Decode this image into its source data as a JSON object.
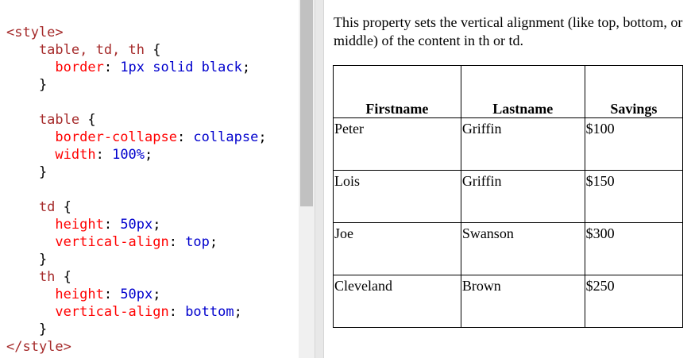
{
  "code_lines": [
    [
      {
        "t": "tag",
        "s": "<style>"
      }
    ],
    [
      {
        "t": "sel",
        "s": "    table, td, th "
      },
      {
        "t": "punc",
        "s": "{"
      }
    ],
    [
      {
        "t": "prop",
        "s": "      border"
      },
      {
        "t": "punc",
        "s": ": "
      },
      {
        "t": "val",
        "s": "1px solid black"
      },
      {
        "t": "punc",
        "s": ";"
      }
    ],
    [
      {
        "t": "punc",
        "s": "    }"
      }
    ],
    [
      {
        "t": "punc",
        "s": ""
      }
    ],
    [
      {
        "t": "sel",
        "s": "    table "
      },
      {
        "t": "punc",
        "s": "{"
      }
    ],
    [
      {
        "t": "prop",
        "s": "      border-collapse"
      },
      {
        "t": "punc",
        "s": ": "
      },
      {
        "t": "val",
        "s": "collapse"
      },
      {
        "t": "punc",
        "s": ";"
      }
    ],
    [
      {
        "t": "prop",
        "s": "      width"
      },
      {
        "t": "punc",
        "s": ": "
      },
      {
        "t": "val",
        "s": "100%"
      },
      {
        "t": "punc",
        "s": ";"
      }
    ],
    [
      {
        "t": "punc",
        "s": "    }"
      }
    ],
    [
      {
        "t": "punc",
        "s": ""
      }
    ],
    [
      {
        "t": "sel",
        "s": "    td "
      },
      {
        "t": "punc",
        "s": "{"
      }
    ],
    [
      {
        "t": "prop",
        "s": "      height"
      },
      {
        "t": "punc",
        "s": ": "
      },
      {
        "t": "val",
        "s": "50px"
      },
      {
        "t": "punc",
        "s": ";"
      }
    ],
    [
      {
        "t": "prop",
        "s": "      vertical-align"
      },
      {
        "t": "punc",
        "s": ": "
      },
      {
        "t": "val",
        "s": "top"
      },
      {
        "t": "punc",
        "s": ";"
      }
    ],
    [
      {
        "t": "punc",
        "s": "    }"
      }
    ],
    [
      {
        "t": "sel",
        "s": "    th "
      },
      {
        "t": "punc",
        "s": "{"
      }
    ],
    [
      {
        "t": "prop",
        "s": "      height"
      },
      {
        "t": "punc",
        "s": ": "
      },
      {
        "t": "val",
        "s": "50px"
      },
      {
        "t": "punc",
        "s": ";"
      }
    ],
    [
      {
        "t": "prop",
        "s": "      vertical-align"
      },
      {
        "t": "punc",
        "s": ": "
      },
      {
        "t": "val",
        "s": "bottom"
      },
      {
        "t": "punc",
        "s": ";"
      }
    ],
    [
      {
        "t": "punc",
        "s": "    }"
      }
    ],
    [
      {
        "t": "tag",
        "s": "</style>"
      }
    ]
  ],
  "result": {
    "description": "This property sets the vertical alignment (like top, bottom, or middle) of the content in th or td.",
    "table": {
      "headers": [
        "Firstname",
        "Lastname",
        "Savings"
      ],
      "rows": [
        [
          "Peter",
          "Griffin",
          "$100"
        ],
        [
          "Lois",
          "Griffin",
          "$150"
        ],
        [
          "Joe",
          "Swanson",
          "$300"
        ],
        [
          "Cleveland",
          "Brown",
          "$250"
        ]
      ]
    }
  },
  "colors": {
    "tag": "#a52a2a",
    "property": "#ff0000",
    "value": "#0000cd",
    "scroll_thumb": "#c1c1c1"
  }
}
